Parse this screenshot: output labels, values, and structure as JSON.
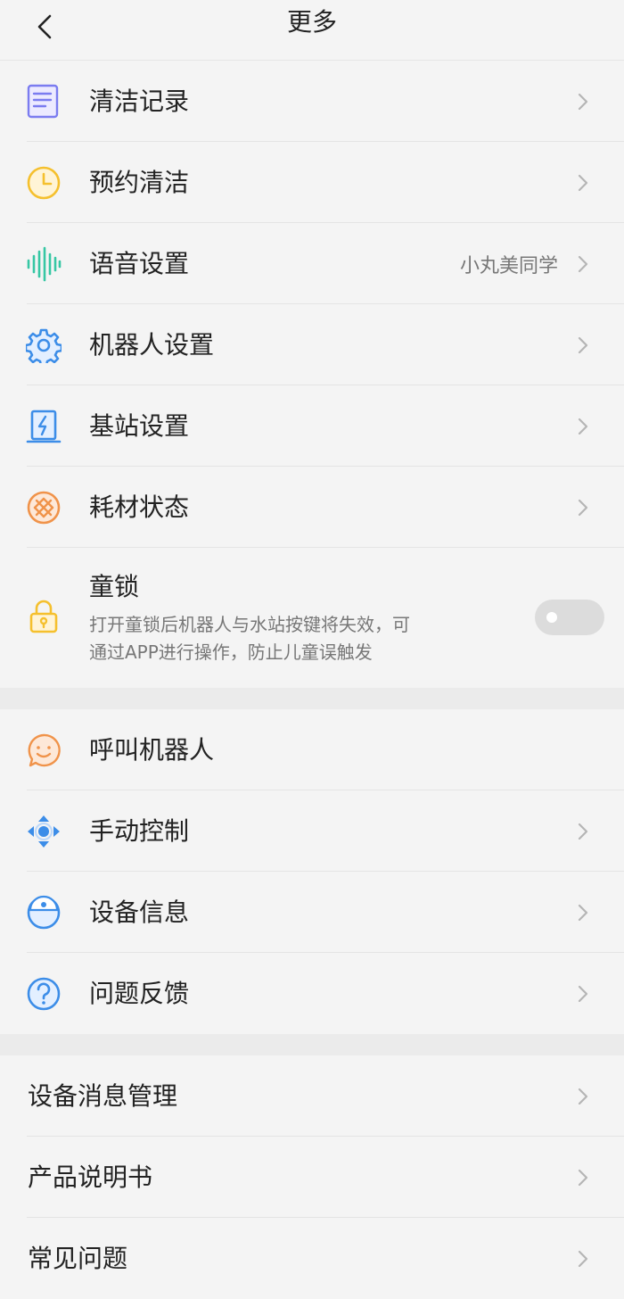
{
  "header": {
    "title": "更多",
    "back_icon": "chevron-left-icon"
  },
  "section1": {
    "items": [
      {
        "label": "清洁记录",
        "icon": "document-list-icon",
        "color": "#7b7cf0"
      },
      {
        "label": "预约清洁",
        "icon": "clock-icon",
        "color": "#f5c02e"
      },
      {
        "label": "语音设置",
        "icon": "voice-wave-icon",
        "color": "#36c7a4",
        "value": "小丸美同学"
      },
      {
        "label": "机器人设置",
        "icon": "gear-icon",
        "color": "#3c8de8"
      },
      {
        "label": "基站设置",
        "icon": "base-station-icon",
        "color": "#3c8de8"
      },
      {
        "label": "耗材状态",
        "icon": "consumable-icon",
        "color": "#f0934a"
      }
    ],
    "child_lock": {
      "title": "童锁",
      "description_line1": "打开童锁后机器人与水站按键将失效，可",
      "description_line2": "通过APP进行操作，防止儿童误触发",
      "icon": "lock-icon",
      "color": "#f5c02e",
      "enabled": false
    }
  },
  "section2": {
    "items": [
      {
        "label": "呼叫机器人",
        "icon": "smile-chat-icon",
        "color": "#f0934a"
      },
      {
        "label": "手动控制",
        "icon": "direction-pad-icon",
        "color": "#3c8de8"
      },
      {
        "label": "设备信息",
        "icon": "robot-device-icon",
        "color": "#3c8de8"
      },
      {
        "label": "问题反馈",
        "icon": "question-icon",
        "color": "#3c8de8"
      }
    ]
  },
  "section3": {
    "items": [
      {
        "label": "设备消息管理"
      },
      {
        "label": "产品说明书"
      },
      {
        "label": "常见问题"
      }
    ]
  }
}
